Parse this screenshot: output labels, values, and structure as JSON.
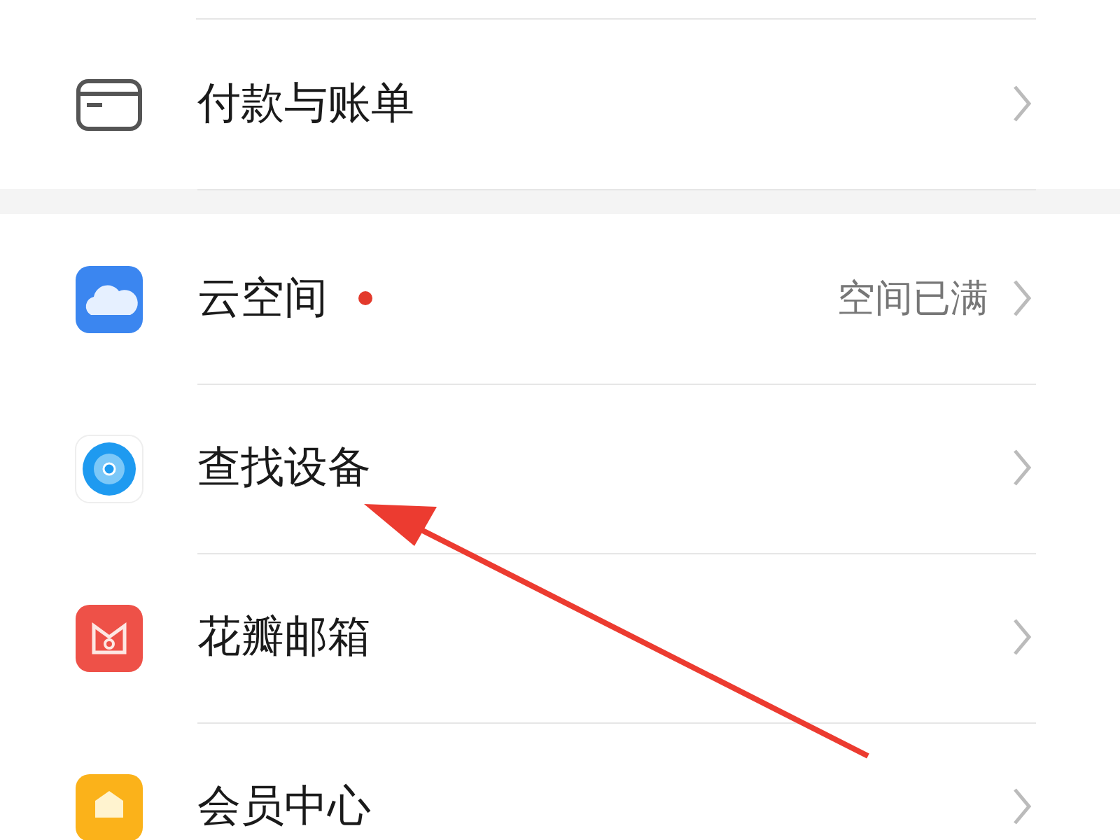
{
  "sections": [
    {
      "items": [
        {
          "kind": "card",
          "label": "付款与账单"
        }
      ]
    },
    {
      "items": [
        {
          "kind": "cloud",
          "label": "云空间",
          "badge_dot": true,
          "detail": "空间已满"
        },
        {
          "kind": "find",
          "label": "查找设备",
          "badge_dot": false
        },
        {
          "kind": "mail",
          "label": "花瓣邮箱",
          "badge_dot": false
        },
        {
          "kind": "member",
          "label": "会员中心",
          "badge_dot": false
        }
      ]
    }
  ]
}
